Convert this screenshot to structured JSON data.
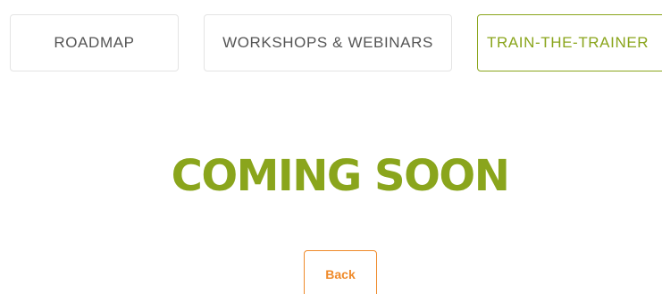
{
  "tabs": [
    {
      "label": "ROADMAP",
      "active": false
    },
    {
      "label": "WORKSHOPS & WEBINARS",
      "active": false
    },
    {
      "label": "TRAIN-THE-TRAINER",
      "active": true
    }
  ],
  "main": {
    "heading": "COMING SOON",
    "back_label": "Back"
  },
  "colors": {
    "accent": "#8aa51c",
    "button": "#ef8a2a",
    "tab_border": "#e4e4e4",
    "tab_text": "#555555"
  }
}
